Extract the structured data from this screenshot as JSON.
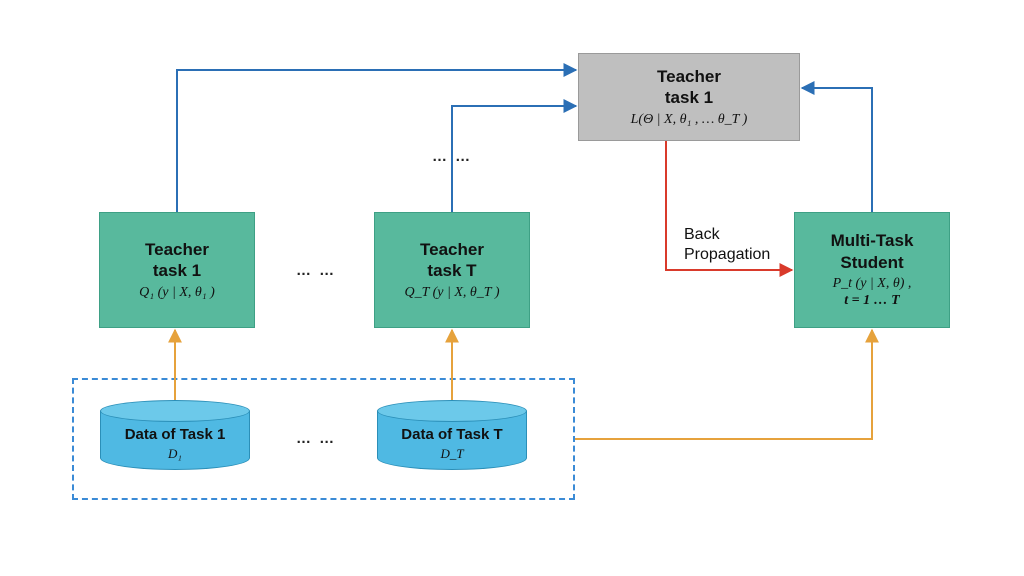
{
  "boxes": {
    "loss": {
      "title1": "Teacher",
      "title2": "task 1",
      "formula": "L(Θ | X, θ₁ , … θ_T )"
    },
    "teacher1": {
      "title1": "Teacher",
      "title2": "task 1",
      "formula": "Q₁ (y | X,  θ₁ )"
    },
    "teacherT": {
      "title1": "Teacher",
      "title2": "task T",
      "formula": "Q_T (y | X, θ_T )"
    },
    "student": {
      "title1": "Multi-Task",
      "title2": "Student",
      "formula1": "P_t  (y | X, θ) ,",
      "formula2": "t = 1 … T"
    }
  },
  "data": {
    "d1": {
      "label": "Data of Task 1",
      "sub": "D₁"
    },
    "dT": {
      "label": "Data of Task T",
      "sub": "D_T"
    }
  },
  "dots": "…  …",
  "backprop": {
    "line1": "Back",
    "line2": "Propagation"
  },
  "colors": {
    "blue": "#2b6fb5",
    "orange": "#e6a23c",
    "red": "#d93a2b"
  }
}
